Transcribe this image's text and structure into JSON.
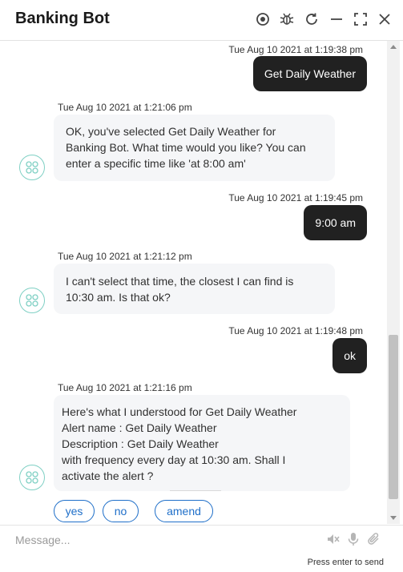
{
  "header": {
    "title": "Banking Bot",
    "icons": [
      "record-icon",
      "bug-icon",
      "refresh-icon",
      "minimize-icon",
      "expand-icon",
      "close-icon"
    ]
  },
  "messages": [
    {
      "from": "user",
      "time": "Tue Aug 10 2021 at 1:19:38 pm",
      "text": "Get Daily Weather"
    },
    {
      "from": "bot",
      "time": "Tue Aug 10 2021 at 1:21:06 pm",
      "lines": [
        "OK, you've selected Get Daily Weather for",
        "Banking Bot. What time would you like? You can",
        "enter a specific time like 'at 8:00 am'"
      ]
    },
    {
      "from": "user",
      "time": "Tue Aug 10 2021 at 1:19:45 pm",
      "text": "9:00 am"
    },
    {
      "from": "bot",
      "time": "Tue Aug 10 2021 at 1:21:12 pm",
      "lines": [
        "I can't select that time, the closest I can find is",
        "10:30 am. Is that ok?"
      ]
    },
    {
      "from": "user",
      "time": "Tue Aug 10 2021 at 1:19:48 pm",
      "text": "ok"
    },
    {
      "from": "bot",
      "time": "Tue Aug 10 2021 at 1:21:16 pm",
      "lines": [
        "Here's what I understood for Get Daily Weather",
        "Alert name : Get Daily Weather",
        "Description : Get Daily Weather",
        "with frequency every day at 10:30 am. Shall I",
        "activate the alert ?"
      ]
    }
  ],
  "quick_replies": [
    "yes",
    "no",
    "amend"
  ],
  "composer": {
    "placeholder": "Message...",
    "hint": "Press enter to send",
    "icons": [
      "mute-icon",
      "microphone-icon",
      "attachment-icon"
    ]
  },
  "colors": {
    "user_bubble": "#212121",
    "bot_bubble": "#f5f6f8",
    "accent": "#1f6fc9",
    "avatar_ring": "#7fd0c4"
  }
}
